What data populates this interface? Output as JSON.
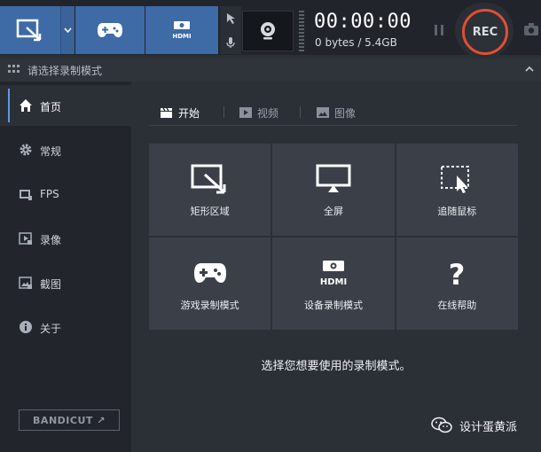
{
  "toolbar": {
    "timer": "00:00:00",
    "file_size": "0 bytes / 5.4GB",
    "rec_label": "REC",
    "hdmi_label": "HDMI"
  },
  "titlebar": {
    "title": "请选择录制模式"
  },
  "sidebar": {
    "items": [
      {
        "label": "首页",
        "icon": "home-icon"
      },
      {
        "label": "常规",
        "icon": "gear-icon"
      },
      {
        "label": "FPS",
        "icon": "fps-icon"
      },
      {
        "label": "录像",
        "icon": "video-icon"
      },
      {
        "label": "截图",
        "icon": "image-icon"
      },
      {
        "label": "关于",
        "icon": "info-icon"
      }
    ],
    "brand": "BANDICUT ↗"
  },
  "main": {
    "tabs": [
      {
        "label": "开始"
      },
      {
        "label": "视频"
      },
      {
        "label": "图像"
      }
    ],
    "tiles": [
      {
        "label": "矩形区域"
      },
      {
        "label": "全屏"
      },
      {
        "label": "追随鼠标"
      },
      {
        "label": "游戏录制模式"
      },
      {
        "label": "设备录制模式"
      },
      {
        "label": "在线帮助"
      }
    ],
    "hint": "选择您想要使用的录制模式。",
    "watermark": "设计蛋黄派",
    "hdmi_tile_label": "HDMI",
    "help_glyph": "?"
  },
  "colors": {
    "accent": "#3e6aa6",
    "rec_ring": "#e14e35",
    "tile_bg": "#3b4048"
  }
}
